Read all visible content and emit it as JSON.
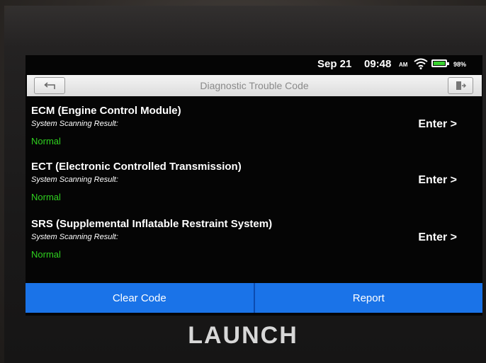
{
  "status_bar": {
    "date": "Sep 21",
    "time": "09:48",
    "ampm": "AM",
    "battery_percent": "98%",
    "battery_level": 0.98
  },
  "header": {
    "title": "Diagnostic Trouble Code",
    "back_icon": "back-arrow-icon",
    "exit_icon": "exit-icon"
  },
  "systems": [
    {
      "name": "ECM (Engine Control Module)",
      "scan_label": "System Scanning Result:",
      "status": "Normal",
      "action": "Enter >"
    },
    {
      "name": "ECT (Electronic Controlled Transmission)",
      "scan_label": "System Scanning Result:",
      "status": "Normal",
      "action": "Enter >"
    },
    {
      "name": "SRS (Supplemental Inflatable Restraint System)",
      "scan_label": "System Scanning Result:",
      "status": "Normal",
      "action": "Enter >"
    }
  ],
  "actions": {
    "clear_code": "Clear Code",
    "report": "Report"
  },
  "brand": "LAUNCH",
  "colors": {
    "accent": "#1a73e8",
    "status_normal": "#2fd11f",
    "battery": "#39d12f"
  }
}
